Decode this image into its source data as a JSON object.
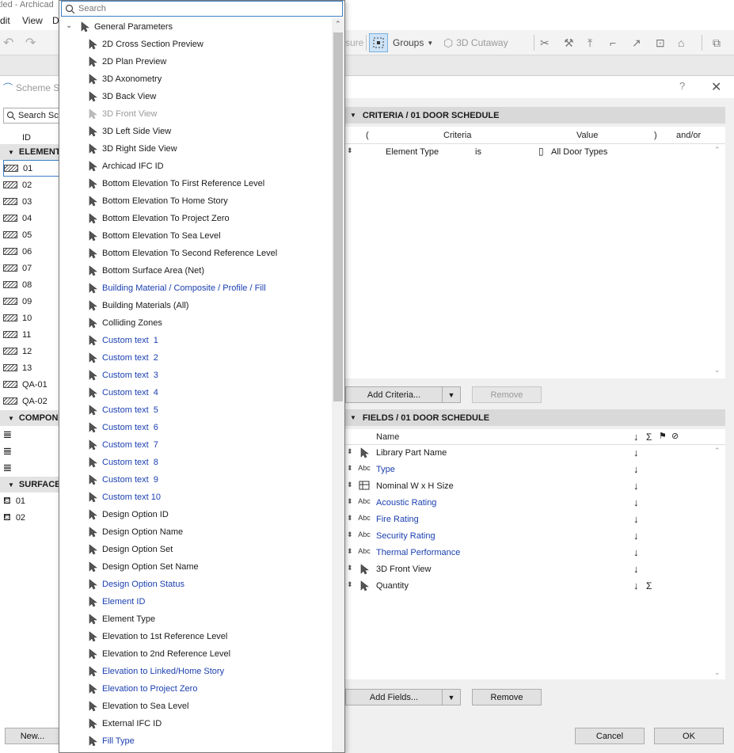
{
  "app": {
    "title_fragment": "tled - Archicad",
    "menu": [
      "dit",
      "View",
      "D"
    ]
  },
  "toolbar": {
    "measure_fragment": "sure",
    "groups_label": "Groups",
    "cutaway_label": "3D Cutaway"
  },
  "scheme_panel": {
    "tab_label": "Scheme S",
    "search_placeholder": "Search Sc",
    "id_header": "ID",
    "group_elements": "ELEMENT",
    "elements": [
      "01",
      "02",
      "03",
      "04",
      "05",
      "06",
      "07",
      "08",
      "09",
      "10",
      "11",
      "12",
      "13",
      "QA-01",
      "QA-02"
    ],
    "group_components": "COMPON",
    "group_surfaces": "SURFACE",
    "surfaces": [
      "01",
      "02"
    ],
    "new_button": "New..."
  },
  "dialog": {
    "help": "?",
    "close": "✕"
  },
  "criteria": {
    "header": "CRITERIA / 01 DOOR SCHEDULE",
    "col_open": "(",
    "col_criteria": "Criteria",
    "col_value": "Value",
    "col_close": ")",
    "col_andor": "and/or",
    "rows": [
      {
        "criteria": "Element Type",
        "operator": "is",
        "value": "All Door Types"
      }
    ],
    "add_button": "Add Criteria...",
    "remove_button": "Remove"
  },
  "fields": {
    "header": "FIELDS / 01 DOOR SCHEDULE",
    "col_name": "Name",
    "rows": [
      {
        "icon": "cursor",
        "name": "Library Part Name",
        "link": false,
        "sum": ""
      },
      {
        "icon": "Abc",
        "name": "Type",
        "link": true,
        "sum": ""
      },
      {
        "icon": "grid",
        "name": "Nominal W x H Size",
        "link": false,
        "sum": ""
      },
      {
        "icon": "Abc",
        "name": "Acoustic Rating",
        "link": true,
        "sum": ""
      },
      {
        "icon": "Abc",
        "name": "Fire Rating",
        "link": true,
        "sum": ""
      },
      {
        "icon": "Abc",
        "name": "Security Rating",
        "link": true,
        "sum": ""
      },
      {
        "icon": "Abc",
        "name": "Thermal Performance",
        "link": true,
        "sum": ""
      },
      {
        "icon": "cursor",
        "name": "3D Front View",
        "link": false,
        "sum": ""
      },
      {
        "icon": "cursor",
        "name": "Quantity",
        "link": false,
        "sum": "Σ"
      }
    ],
    "add_button": "Add Fields...",
    "remove_button": "Remove"
  },
  "footer": {
    "cancel": "Cancel",
    "ok": "OK"
  },
  "popup": {
    "search_placeholder": "Search",
    "group_label": "General Parameters",
    "items": [
      {
        "label": "2D Cross Section Preview",
        "style": "normal"
      },
      {
        "label": "2D Plan Preview",
        "style": "normal"
      },
      {
        "label": "3D Axonometry",
        "style": "normal"
      },
      {
        "label": "3D Back View",
        "style": "normal"
      },
      {
        "label": "3D Front View",
        "style": "dim"
      },
      {
        "label": "3D Left Side View",
        "style": "normal"
      },
      {
        "label": "3D Right Side View",
        "style": "normal"
      },
      {
        "label": "Archicad IFC ID",
        "style": "normal"
      },
      {
        "label": "Bottom Elevation To First Reference Level",
        "style": "normal"
      },
      {
        "label": "Bottom Elevation To Home Story",
        "style": "normal"
      },
      {
        "label": "Bottom Elevation To Project Zero",
        "style": "normal"
      },
      {
        "label": "Bottom Elevation To Sea Level",
        "style": "normal"
      },
      {
        "label": "Bottom Elevation To Second Reference Level",
        "style": "normal"
      },
      {
        "label": "Bottom Surface Area (Net)",
        "style": "normal"
      },
      {
        "label": "Building Material / Composite / Profile / Fill",
        "style": "link"
      },
      {
        "label": "Building Materials (All)",
        "style": "normal"
      },
      {
        "label": "Colliding Zones",
        "style": "normal"
      },
      {
        "label": "Custom text  1",
        "style": "link"
      },
      {
        "label": "Custom text  2",
        "style": "link"
      },
      {
        "label": "Custom text  3",
        "style": "link"
      },
      {
        "label": "Custom text  4",
        "style": "link"
      },
      {
        "label": "Custom text  5",
        "style": "link"
      },
      {
        "label": "Custom text  6",
        "style": "link"
      },
      {
        "label": "Custom text  7",
        "style": "link"
      },
      {
        "label": "Custom text  8",
        "style": "link"
      },
      {
        "label": "Custom text  9",
        "style": "link"
      },
      {
        "label": "Custom text 10",
        "style": "link"
      },
      {
        "label": "Design Option ID",
        "style": "normal"
      },
      {
        "label": "Design Option Name",
        "style": "normal"
      },
      {
        "label": "Design Option Set",
        "style": "normal"
      },
      {
        "label": "Design Option Set Name",
        "style": "normal"
      },
      {
        "label": "Design Option Status",
        "style": "link"
      },
      {
        "label": "Element ID",
        "style": "link"
      },
      {
        "label": "Element Type",
        "style": "normal"
      },
      {
        "label": "Elevation to 1st Reference Level",
        "style": "normal"
      },
      {
        "label": "Elevation to 2nd Reference Level",
        "style": "normal"
      },
      {
        "label": "Elevation to Linked/Home Story",
        "style": "link"
      },
      {
        "label": "Elevation to Project Zero",
        "style": "link"
      },
      {
        "label": "Elevation to Sea Level",
        "style": "normal"
      },
      {
        "label": "External IFC ID",
        "style": "normal"
      },
      {
        "label": "Fill Type",
        "style": "link"
      }
    ]
  },
  "colors": {
    "link": "#1b3fb0",
    "selection": "#3c7fc4",
    "section_header": "#d9d9d9"
  }
}
